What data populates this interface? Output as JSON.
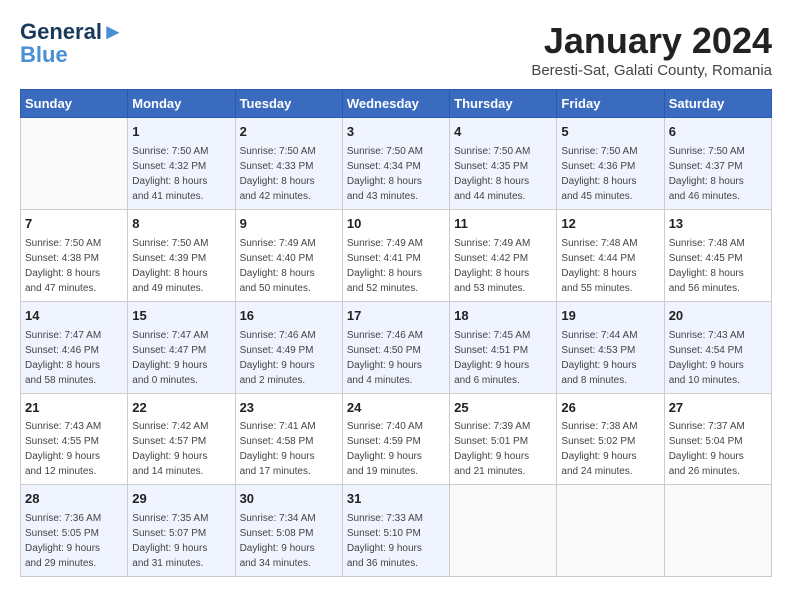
{
  "header": {
    "logo_line1": "General",
    "logo_line2": "Blue",
    "month": "January 2024",
    "location": "Beresti-Sat, Galati County, Romania"
  },
  "days_of_week": [
    "Sunday",
    "Monday",
    "Tuesday",
    "Wednesday",
    "Thursday",
    "Friday",
    "Saturday"
  ],
  "weeks": [
    [
      {
        "day": "",
        "info": ""
      },
      {
        "day": "1",
        "info": "Sunrise: 7:50 AM\nSunset: 4:32 PM\nDaylight: 8 hours\nand 41 minutes."
      },
      {
        "day": "2",
        "info": "Sunrise: 7:50 AM\nSunset: 4:33 PM\nDaylight: 8 hours\nand 42 minutes."
      },
      {
        "day": "3",
        "info": "Sunrise: 7:50 AM\nSunset: 4:34 PM\nDaylight: 8 hours\nand 43 minutes."
      },
      {
        "day": "4",
        "info": "Sunrise: 7:50 AM\nSunset: 4:35 PM\nDaylight: 8 hours\nand 44 minutes."
      },
      {
        "day": "5",
        "info": "Sunrise: 7:50 AM\nSunset: 4:36 PM\nDaylight: 8 hours\nand 45 minutes."
      },
      {
        "day": "6",
        "info": "Sunrise: 7:50 AM\nSunset: 4:37 PM\nDaylight: 8 hours\nand 46 minutes."
      }
    ],
    [
      {
        "day": "7",
        "info": "Sunrise: 7:50 AM\nSunset: 4:38 PM\nDaylight: 8 hours\nand 47 minutes."
      },
      {
        "day": "8",
        "info": "Sunrise: 7:50 AM\nSunset: 4:39 PM\nDaylight: 8 hours\nand 49 minutes."
      },
      {
        "day": "9",
        "info": "Sunrise: 7:49 AM\nSunset: 4:40 PM\nDaylight: 8 hours\nand 50 minutes."
      },
      {
        "day": "10",
        "info": "Sunrise: 7:49 AM\nSunset: 4:41 PM\nDaylight: 8 hours\nand 52 minutes."
      },
      {
        "day": "11",
        "info": "Sunrise: 7:49 AM\nSunset: 4:42 PM\nDaylight: 8 hours\nand 53 minutes."
      },
      {
        "day": "12",
        "info": "Sunrise: 7:48 AM\nSunset: 4:44 PM\nDaylight: 8 hours\nand 55 minutes."
      },
      {
        "day": "13",
        "info": "Sunrise: 7:48 AM\nSunset: 4:45 PM\nDaylight: 8 hours\nand 56 minutes."
      }
    ],
    [
      {
        "day": "14",
        "info": "Sunrise: 7:47 AM\nSunset: 4:46 PM\nDaylight: 8 hours\nand 58 minutes."
      },
      {
        "day": "15",
        "info": "Sunrise: 7:47 AM\nSunset: 4:47 PM\nDaylight: 9 hours\nand 0 minutes."
      },
      {
        "day": "16",
        "info": "Sunrise: 7:46 AM\nSunset: 4:49 PM\nDaylight: 9 hours\nand 2 minutes."
      },
      {
        "day": "17",
        "info": "Sunrise: 7:46 AM\nSunset: 4:50 PM\nDaylight: 9 hours\nand 4 minutes."
      },
      {
        "day": "18",
        "info": "Sunrise: 7:45 AM\nSunset: 4:51 PM\nDaylight: 9 hours\nand 6 minutes."
      },
      {
        "day": "19",
        "info": "Sunrise: 7:44 AM\nSunset: 4:53 PM\nDaylight: 9 hours\nand 8 minutes."
      },
      {
        "day": "20",
        "info": "Sunrise: 7:43 AM\nSunset: 4:54 PM\nDaylight: 9 hours\nand 10 minutes."
      }
    ],
    [
      {
        "day": "21",
        "info": "Sunrise: 7:43 AM\nSunset: 4:55 PM\nDaylight: 9 hours\nand 12 minutes."
      },
      {
        "day": "22",
        "info": "Sunrise: 7:42 AM\nSunset: 4:57 PM\nDaylight: 9 hours\nand 14 minutes."
      },
      {
        "day": "23",
        "info": "Sunrise: 7:41 AM\nSunset: 4:58 PM\nDaylight: 9 hours\nand 17 minutes."
      },
      {
        "day": "24",
        "info": "Sunrise: 7:40 AM\nSunset: 4:59 PM\nDaylight: 9 hours\nand 19 minutes."
      },
      {
        "day": "25",
        "info": "Sunrise: 7:39 AM\nSunset: 5:01 PM\nDaylight: 9 hours\nand 21 minutes."
      },
      {
        "day": "26",
        "info": "Sunrise: 7:38 AM\nSunset: 5:02 PM\nDaylight: 9 hours\nand 24 minutes."
      },
      {
        "day": "27",
        "info": "Sunrise: 7:37 AM\nSunset: 5:04 PM\nDaylight: 9 hours\nand 26 minutes."
      }
    ],
    [
      {
        "day": "28",
        "info": "Sunrise: 7:36 AM\nSunset: 5:05 PM\nDaylight: 9 hours\nand 29 minutes."
      },
      {
        "day": "29",
        "info": "Sunrise: 7:35 AM\nSunset: 5:07 PM\nDaylight: 9 hours\nand 31 minutes."
      },
      {
        "day": "30",
        "info": "Sunrise: 7:34 AM\nSunset: 5:08 PM\nDaylight: 9 hours\nand 34 minutes."
      },
      {
        "day": "31",
        "info": "Sunrise: 7:33 AM\nSunset: 5:10 PM\nDaylight: 9 hours\nand 36 minutes."
      },
      {
        "day": "",
        "info": ""
      },
      {
        "day": "",
        "info": ""
      },
      {
        "day": "",
        "info": ""
      }
    ]
  ]
}
